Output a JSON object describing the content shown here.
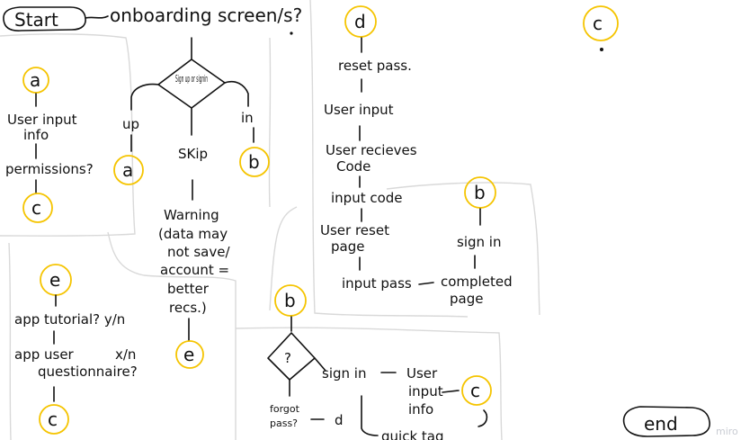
{
  "start": "Start",
  "onboarding": "onboarding screen/s?",
  "c_top": "c",
  "decision_top": "Sign up or signin",
  "branch_up": "up",
  "branch_skip": "SKip",
  "branch_in": "in",
  "a_mid": "a",
  "b_mid": "b",
  "warning": [
    "Warning",
    "(data may",
    "not save/",
    "account =",
    "better",
    "recs.)"
  ],
  "e_mid": "e",
  "a_top": "a",
  "user_input_info": [
    "User input",
    "info"
  ],
  "permissions": "permissions?",
  "c_left": "c",
  "d_top": "d",
  "reset_pass": "reset pass.",
  "user_input": "User input",
  "user_recieves": [
    "User recieves",
    "Code"
  ],
  "input_code": "input code",
  "user_reset_page": [
    "User reset",
    "page"
  ],
  "input_pass": "input pass",
  "completed_page": [
    "completed",
    "page"
  ],
  "b_right": "b",
  "sign_in_right": "sign in",
  "e_bottom": "e",
  "app_tutorial": "app tutorial? y/n",
  "app_user": "app user",
  "x_n": "x/n",
  "questionnaire": "questionnaire?",
  "c_bottom_left": "c",
  "b_bottom": "b",
  "decision_bottom": "?",
  "sign_in_bottom": "sign in",
  "user_input_info_bottom": [
    "User",
    "input",
    "info"
  ],
  "c_bottom": "c",
  "forgot_pass": [
    "forgot",
    "pass?"
  ],
  "d_bottom": "d",
  "quick_tag": "quick tag",
  "end": "end",
  "watermark": "miro"
}
